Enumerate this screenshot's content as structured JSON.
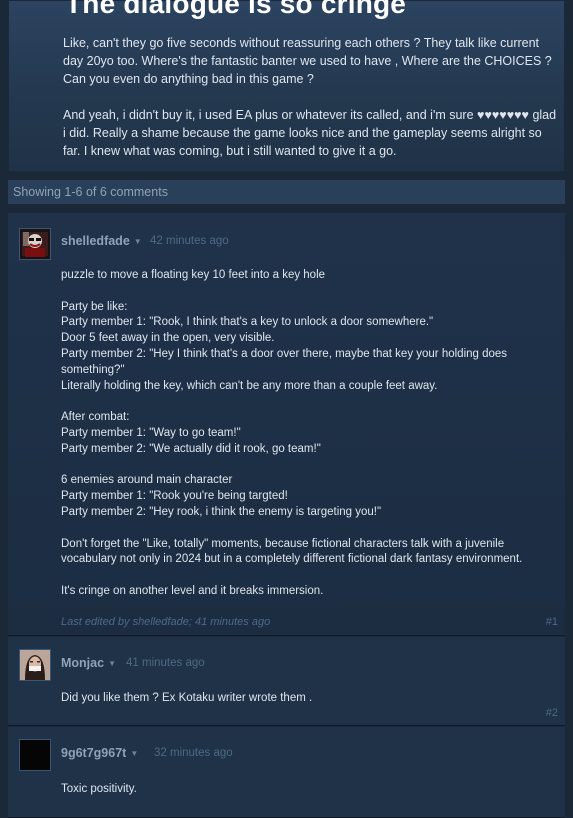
{
  "topic": {
    "title": "The dialogue is so cringe",
    "paragraphs": [
      "Like, can't they go five seconds without reassuring each others ? They talk like current day 20yo too. Where's the fantastic banter we used to have , Where are the CHOICES ? Can you even do anything bad in this game ?",
      "And yeah, i didn't buy it, i used EA plus or whatever its called, and i'm sure ♥♥♥♥♥♥♥ glad i did. Really a shame because the game looks nice and the gameplay seems alright so far. I knew what was coming, but i still wanted to give it a go."
    ]
  },
  "comments_count_text": "Showing 1-6 of 6 comments",
  "comments": [
    {
      "author": "shelledfade",
      "timestamp": "42 minutes ago",
      "paragraphs": [
        [
          "puzzle to move a floating key 10 feet into a key hole"
        ],
        [
          "Party be like:",
          "Party member 1: \"Rook, I think that's a key to unlock a door somewhere.\"",
          "Door 5 feet away in the open, very visible.",
          "Party member 2: \"Hey I think that's a door over there, maybe that key your holding does something?\"",
          "Literally holding the key, which can't be any more than a couple feet away."
        ],
        [
          "After combat:",
          "Party member 1: \"Way to go team!\"",
          "Party member 2: \"We actually did it rook, go team!\""
        ],
        [
          "6 enemies around main character",
          "Party member 1: \"Rook you're being targted!",
          "Party member 2: \"Hey rook, i think the enemy is targeting you!\""
        ],
        [
          "Don't forget the \"Like, totally\" moments, because fictional characters talk with a juvenile vocabulary not only in 2024 but in a completely different fictional dark fantasy environment."
        ],
        [
          "It's cringe on another level and it breaks immersion."
        ]
      ],
      "edited_prefix": "Last edited by",
      "edited_by": "shelledfade",
      "edited_time": "41 minutes ago",
      "post_number": "#1"
    },
    {
      "author": "Monjac",
      "timestamp": "41 minutes ago",
      "text": "Did you like them ? Ex Kotaku writer wrote them .",
      "post_number": "#2"
    },
    {
      "author": "9g6t7g967t",
      "timestamp": "32 minutes ago",
      "text": "Toxic positivity."
    }
  ],
  "colors": {
    "page_bg": "#1b2838",
    "topic_bg": "#2c4461",
    "comment_bg": "#1f3247",
    "author_color": "#8fa3b8",
    "muted_text": "#4c6b85"
  },
  "icons": {
    "author_menu": "caret-down-icon"
  }
}
